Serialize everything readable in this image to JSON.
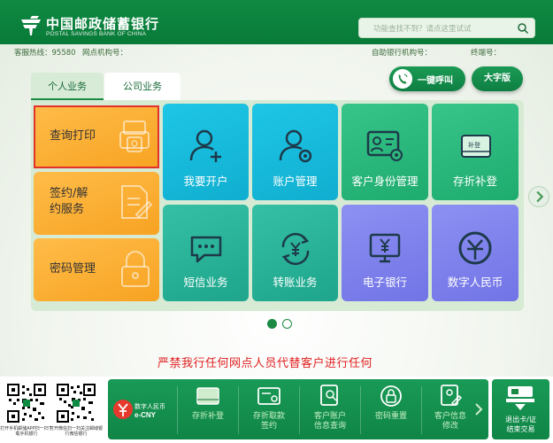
{
  "header": {
    "bank_name_cn": "中国邮政储蓄银行",
    "bank_name_en": "POSTAL SAVINGS BANK OF CHINA",
    "search_placeholder": "功能查找不到？请点这里试试",
    "brand_color": "#0f8a43"
  },
  "info": {
    "hotline": "客服热线：95580",
    "branch": "网点机构号：",
    "atm": "自助银行机构号：",
    "terminal": "终端号："
  },
  "tabs": [
    {
      "label": "个人业务",
      "active": true
    },
    {
      "label": "公司业务",
      "active": false
    }
  ],
  "actions": {
    "call": "一键呼叫",
    "large_font": "大字版"
  },
  "left_menu": [
    {
      "label": "查询打印",
      "icon": "print-icon",
      "selected": true
    },
    {
      "label_line1": "签约/解",
      "label_line2": "约服务",
      "icon": "document-edit-icon"
    },
    {
      "label": "密码管理",
      "icon": "lock-icon"
    }
  ],
  "tiles": [
    {
      "label": "我要开户",
      "icon": "add-user-icon",
      "color": "cyan"
    },
    {
      "label": "账户管理",
      "icon": "user-settings-icon",
      "color": "cyan"
    },
    {
      "label": "客户身份管理",
      "icon": "id-card-icon",
      "color": "green"
    },
    {
      "label": "存折补登",
      "icon": "passbook-icon",
      "color": "green",
      "badge": "补登"
    },
    {
      "label": "短信业务",
      "icon": "sms-icon",
      "color": "teal"
    },
    {
      "label": "转账业务",
      "icon": "transfer-icon",
      "color": "teal"
    },
    {
      "label": "电子银行",
      "icon": "e-bank-icon",
      "color": "purple"
    },
    {
      "label": "数字人民币",
      "icon": "digital-rmb-icon",
      "color": "purple"
    }
  ],
  "pagination": {
    "current": 1,
    "total": 2
  },
  "warning": "严禁我行任何网点人员代替客户进行任何",
  "footer": {
    "qr1_caption": "打开手机邮储APP扫一扫下载手机银行",
    "qr2_caption": "打开微信扫一扫关注邮储银行微信银行",
    "ecny_line1": "数字人民币",
    "ecny_line2": "e-CNY",
    "items": [
      {
        "label": "存折补登",
        "icon": "passbook-icon"
      },
      {
        "label_line1": "存折取款",
        "label_line2": "签约",
        "icon": "passbook-withdraw-icon"
      },
      {
        "label_line1": "客户账户",
        "label_line2": "信息查询",
        "icon": "account-query-icon"
      },
      {
        "label": "密码重置",
        "icon": "password-reset-icon"
      },
      {
        "label_line1": "客户信息",
        "label_line2": "修改",
        "icon": "info-edit-icon"
      }
    ],
    "eject_line1": "退出卡/证",
    "eject_line2": "结束交易"
  }
}
